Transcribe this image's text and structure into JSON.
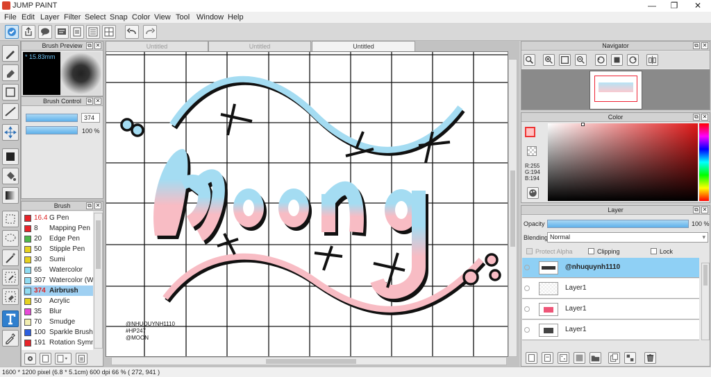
{
  "app": {
    "title": "JUMP PAINT"
  },
  "window_buttons": {
    "minimize": "—",
    "maximize": "❐",
    "close": "✕"
  },
  "menu": [
    "File",
    "Edit",
    "Layer",
    "Filter",
    "Select",
    "Snap",
    "Color",
    "View",
    "Tool",
    "Window",
    "Help"
  ],
  "tabs": [
    "Untitled",
    "Untitled",
    "Untitled"
  ],
  "brush_preview": {
    "title": "Brush Preview",
    "size": "* 15.83mm"
  },
  "brush_control": {
    "title": "Brush Control",
    "size_value": "374",
    "opacity_value": "100 %"
  },
  "brush": {
    "title": "Brush",
    "items": [
      {
        "color": "#e8242a",
        "size": "16.4",
        "name": "G Pen",
        "selected": false
      },
      {
        "color": "#e8242a",
        "size": "8",
        "name": "Mapping Pen",
        "selected": false
      },
      {
        "color": "#4fb84a",
        "size": "20",
        "name": "Edge Pen",
        "selected": false
      },
      {
        "color": "#e6d21f",
        "size": "50",
        "name": "Stipple Pen",
        "selected": false
      },
      {
        "color": "#e6d21f",
        "size": "30",
        "name": "Sumi",
        "selected": false
      },
      {
        "color": "#8fdcf2",
        "size": "65",
        "name": "Watercolor",
        "selected": false
      },
      {
        "color": "#8fdcf2",
        "size": "307",
        "name": "Watercolor (Wet)",
        "selected": false
      },
      {
        "color": "#8fdcf2",
        "size": "374",
        "name": "Airbrush",
        "selected": true
      },
      {
        "color": "#e6d21f",
        "size": "50",
        "name": "Acrylic",
        "selected": false
      },
      {
        "color": "#e84ad8",
        "size": "35",
        "name": "Blur",
        "selected": false
      },
      {
        "color": "#f2eeb0",
        "size": "70",
        "name": "Smudge",
        "selected": false
      },
      {
        "color": "#2c5fe0",
        "size": "100",
        "name": "Sparkle Brush",
        "selected": false
      },
      {
        "color": "#e8242a",
        "size": "191",
        "name": "Rotation Symmetry",
        "selected": false
      }
    ]
  },
  "artwork": {
    "signature_lines": [
      "@NHUQUYNH1110",
      "#HP247",
      "@MOON"
    ]
  },
  "navigator": {
    "title": "Navigator"
  },
  "color": {
    "title": "Color",
    "r": "R:255",
    "g": "G:194",
    "b": "B:194",
    "main_color": "#ffc2c2"
  },
  "layer": {
    "title": "Layer",
    "opacity_label": "Opacity",
    "opacity_value": "100 %",
    "blending_label": "Blending",
    "blending_value": "Normal",
    "protect_alpha": "Protect Alpha",
    "clipping": "Clipping",
    "lock": "Lock",
    "layers": [
      {
        "name": "@nhuquynh1110",
        "selected": true
      },
      {
        "name": "Layer1",
        "selected": false
      },
      {
        "name": "Layer1",
        "selected": false
      },
      {
        "name": "Layer1",
        "selected": false
      }
    ]
  },
  "status": {
    "text": "1600 * 1200 pixel   (6.8 * 5.1cm)   600 dpi   66 %   ( 272, 941 )"
  }
}
